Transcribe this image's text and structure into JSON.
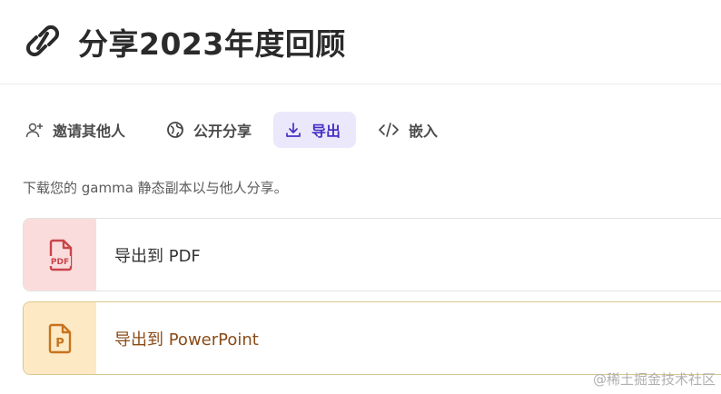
{
  "header": {
    "title": "分享2023年度回顾",
    "icon": "link-icon"
  },
  "tabs": [
    {
      "label": "邀请其他人",
      "icon": "add-person-icon",
      "active": false
    },
    {
      "label": "公开分享",
      "icon": "globe-icon",
      "active": false
    },
    {
      "label": "导出",
      "icon": "download-icon",
      "active": true
    },
    {
      "label": "嵌入",
      "icon": "code-icon",
      "active": false
    }
  ],
  "description": "下载您的 gamma 静态副本以与他人分享。",
  "export_options": [
    {
      "label": "导出到 PDF",
      "icon": "pdf-file-icon",
      "icon_text": "PDF",
      "accent": "#c8454a",
      "thumb_bg": "#fbdcdc"
    },
    {
      "label": "导出到 PowerPoint",
      "icon": "powerpoint-file-icon",
      "icon_text": "P",
      "accent": "#c8731e",
      "thumb_bg": "#fde9c4"
    }
  ],
  "colors": {
    "active_tab_bg": "#ece8fb",
    "active_tab_text": "#4431c4"
  },
  "watermark": "@稀土掘金技术社区"
}
